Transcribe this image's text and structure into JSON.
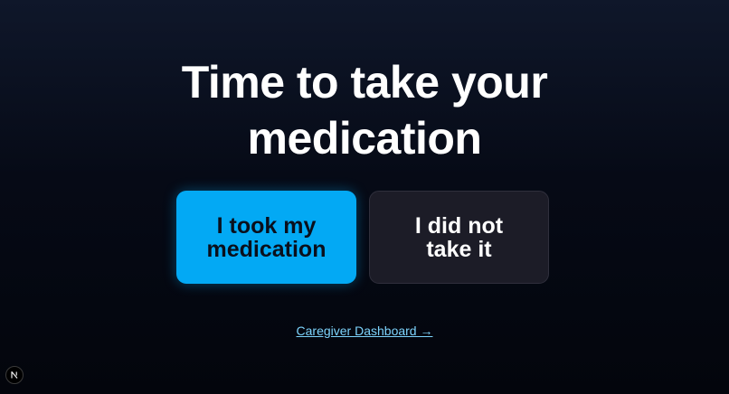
{
  "title": {
    "line1": "Time to take your",
    "line2": "medication"
  },
  "actions": {
    "took": {
      "line1": "I took my",
      "line2": "medication"
    },
    "not_taken": {
      "line1": "I did not",
      "line2": "take it"
    }
  },
  "caregiver_link": {
    "label": "Caregiver Dashboard →"
  },
  "dev_badge": {
    "icon": "nextjs-logo-icon"
  },
  "colors": {
    "primary": "#03a9f4",
    "secondary_bg": "#1c1c27",
    "link": "#7dd3fc"
  }
}
